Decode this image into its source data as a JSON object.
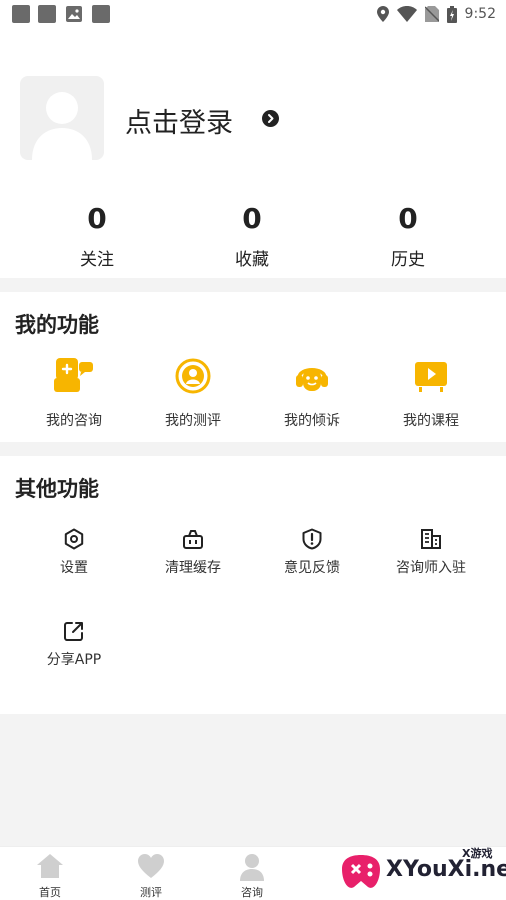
{
  "status_bar": {
    "time": "9:52"
  },
  "profile": {
    "login_text": "点击登录"
  },
  "stats": [
    {
      "value": "0",
      "label": "关注"
    },
    {
      "value": "0",
      "label": "收藏"
    },
    {
      "value": "0",
      "label": "历史"
    }
  ],
  "my_functions": {
    "title": "我的功能",
    "items": [
      {
        "label": "我的咨询",
        "icon": "consultant-icon"
      },
      {
        "label": "我的测评",
        "icon": "assessment-icon"
      },
      {
        "label": "我的倾诉",
        "icon": "headset-icon"
      },
      {
        "label": "我的课程",
        "icon": "video-course-icon"
      }
    ],
    "accent": "#f7b500"
  },
  "other_functions": {
    "title": "其他功能",
    "items": [
      {
        "label": "设置",
        "icon": "gear-icon"
      },
      {
        "label": "清理缓存",
        "icon": "basket-icon"
      },
      {
        "label": "意见反馈",
        "icon": "alert-shield-icon"
      },
      {
        "label": "咨询师入驻",
        "icon": "building-icon"
      },
      {
        "label": "分享APP",
        "icon": "share-icon"
      }
    ]
  },
  "tabs": [
    {
      "label": "首页",
      "icon": "home-icon"
    },
    {
      "label": "测评",
      "icon": "heart-icon"
    },
    {
      "label": "咨询",
      "icon": "person-icon"
    },
    {
      "label": "",
      "icon": "tab-icon"
    },
    {
      "label": "",
      "icon": "tab-icon"
    }
  ],
  "watermark": {
    "text": "XYouXi.net",
    "small": "X游戏"
  }
}
